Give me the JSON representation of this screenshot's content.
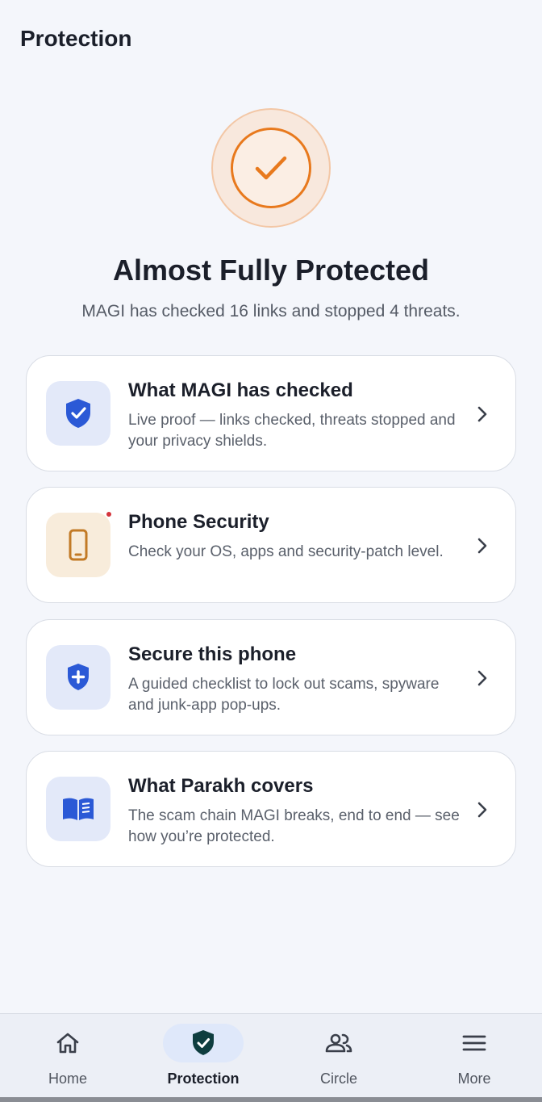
{
  "header": {
    "title": "Protection"
  },
  "status": {
    "headline": "Almost Fully Protected",
    "summary": "MAGI has checked 16 links and stopped 4 threats.",
    "accent_color": "#e8791d"
  },
  "cards": [
    {
      "title": "What MAGI has checked",
      "description": "Live proof — links checked, threats stopped and your privacy shields.",
      "icon": "shield-check-icon"
    },
    {
      "title": "Phone Security",
      "description": "Check your OS, apps and security-patch level.",
      "icon": "phone-icon",
      "has_alert_dot": true
    },
    {
      "title": "Secure this phone",
      "description": "A guided checklist to lock out scams, spyware and junk-app pop-ups.",
      "icon": "shield-plus-icon"
    },
    {
      "title": "What Parakh covers",
      "description": "The scam chain MAGI breaks, end to end — see how you’re protected.",
      "icon": "book-icon"
    }
  ],
  "nav": {
    "items": [
      {
        "label": "Home",
        "icon": "home-icon",
        "active": false
      },
      {
        "label": "Protection",
        "icon": "shield-check-icon",
        "active": true
      },
      {
        "label": "Circle",
        "icon": "people-icon",
        "active": false
      },
      {
        "label": "More",
        "icon": "menu-icon",
        "active": false
      }
    ]
  }
}
